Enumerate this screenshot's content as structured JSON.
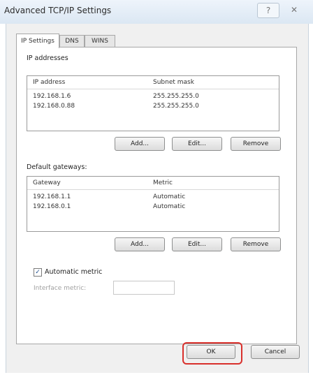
{
  "window": {
    "title": "Advanced TCP/IP Settings",
    "help_glyph": "?",
    "close_glyph": "✕"
  },
  "tabs": [
    {
      "label": "IP Settings",
      "active": true
    },
    {
      "label": "DNS",
      "active": false
    },
    {
      "label": "WINS",
      "active": false
    }
  ],
  "ip_section": {
    "title": "IP addresses",
    "columns": [
      "IP address",
      "Subnet mask"
    ],
    "rows": [
      [
        "192.168.1.6",
        "255.255.255.0"
      ],
      [
        "192.168.0.88",
        "255.255.255.0"
      ]
    ],
    "add_label": "Add...",
    "edit_label": "Edit...",
    "remove_label": "Remove"
  },
  "gateway_section": {
    "title": "Default gateways:",
    "columns": [
      "Gateway",
      "Metric"
    ],
    "rows": [
      [
        "192.168.1.1",
        "Automatic"
      ],
      [
        "192.168.0.1",
        "Automatic"
      ]
    ],
    "add_label": "Add...",
    "edit_label": "Edit...",
    "remove_label": "Remove"
  },
  "metric": {
    "automatic_label": "Automatic metric",
    "automatic_checked": true,
    "interface_label": "Interface metric:",
    "interface_value": ""
  },
  "footer": {
    "ok_label": "OK",
    "cancel_label": "Cancel",
    "highlight_color": "#d9302c"
  }
}
